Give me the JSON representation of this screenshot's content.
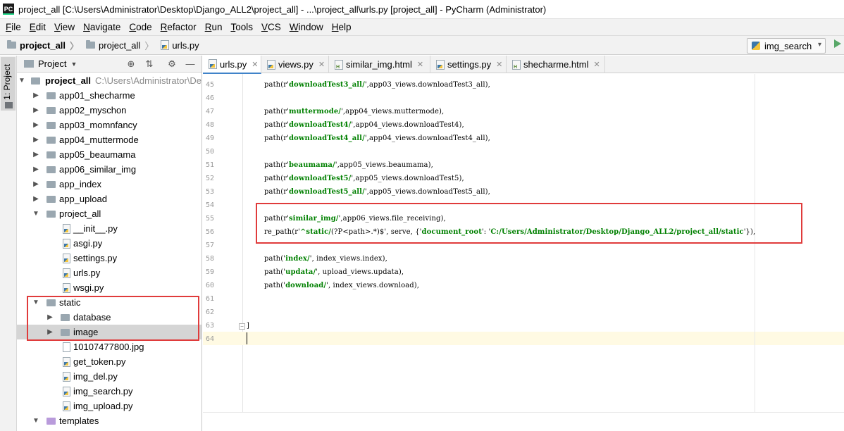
{
  "window": {
    "title": "project_all [C:\\Users\\Administrator\\Desktop\\Django_ALL2\\project_all] - ...\\project_all\\urls.py [project_all] - PyCharm (Administrator)",
    "app_icon_text": "PC"
  },
  "menu": [
    "File",
    "Edit",
    "View",
    "Navigate",
    "Code",
    "Refactor",
    "Run",
    "Tools",
    "VCS",
    "Window",
    "Help"
  ],
  "breadcrumb": [
    "project_all",
    "project_all",
    "urls.py"
  ],
  "run_config": {
    "label": "img_search"
  },
  "tool_strip": {
    "label": "1: Project"
  },
  "project_panel": {
    "title": "Project",
    "tree": [
      {
        "label": "project_all",
        "path": "C:\\Users\\Administrator\\De"
      },
      {
        "label": "app01_shecharme"
      },
      {
        "label": "app02_myschon"
      },
      {
        "label": "app03_momnfancy"
      },
      {
        "label": "app04_muttermode"
      },
      {
        "label": "app05_beaumama"
      },
      {
        "label": "app06_similar_img"
      },
      {
        "label": "app_index"
      },
      {
        "label": "app_upload"
      },
      {
        "label": "project_all"
      },
      {
        "label": "__init__.py"
      },
      {
        "label": "asgi.py"
      },
      {
        "label": "settings.py"
      },
      {
        "label": "urls.py"
      },
      {
        "label": "wsgi.py"
      },
      {
        "label": "static"
      },
      {
        "label": "database"
      },
      {
        "label": "image"
      },
      {
        "label": "10107477800.jpg"
      },
      {
        "label": "get_token.py"
      },
      {
        "label": "img_del.py"
      },
      {
        "label": "img_search.py"
      },
      {
        "label": "img_upload.py"
      },
      {
        "label": "templates"
      }
    ]
  },
  "editor": {
    "tabs": [
      {
        "label": "urls.py"
      },
      {
        "label": "views.py"
      },
      {
        "label": "similar_img.html"
      },
      {
        "label": "settings.py"
      },
      {
        "label": "shecharme.html"
      }
    ],
    "line_numbers": [
      "45",
      "46",
      "47",
      "48",
      "49",
      "50",
      "51",
      "52",
      "53",
      "54",
      "55",
      "56",
      "57",
      "58",
      "59",
      "60",
      "61",
      "62",
      "63",
      "64"
    ],
    "lines": [
      [
        "path(r'",
        "downloadTest3_all/",
        "',app03_views.downloadTest3_all),"
      ],
      [
        "",
        "",
        ""
      ],
      [
        "path(r'",
        "muttermode/",
        "',app04_views.muttermode),"
      ],
      [
        "path(r'",
        "downloadTest4/",
        "',app04_views.downloadTest4),"
      ],
      [
        "path(r'",
        "downloadTest4_all/",
        "',app04_views.downloadTest4_all),"
      ],
      [
        "",
        "",
        ""
      ],
      [
        "path(r'",
        "beaumama/",
        "',app05_views.beaumama),"
      ],
      [
        "path(r'",
        "downloadTest5/",
        "',app05_views.downloadTest5),"
      ],
      [
        "path(r'",
        "downloadTest5_all/",
        "',app05_views.downloadTest5_all),"
      ],
      [
        "",
        "",
        ""
      ],
      [
        "path(r'",
        "similar_img/",
        "',app06_views.file_receiving),"
      ],
      [
        "re_path(r'",
        "^static/",
        "(?P<path>.*)$', serve, {'",
        "document_root",
        "': '",
        "C:/Users/Administrator/Desktop/Django_ALL2/project_all/static",
        "'}),"
      ],
      [
        "",
        "",
        ""
      ],
      [
        "path('",
        "index/",
        "', index_views.index),"
      ],
      [
        "path('",
        "updata/",
        "', upload_views.updata),"
      ],
      [
        "path('",
        "download/",
        "', index_views.download),"
      ],
      [
        "",
        "",
        ""
      ],
      [
        "",
        "",
        ""
      ],
      [
        "]",
        "",
        ""
      ],
      [
        "",
        "",
        ""
      ]
    ]
  },
  "colors": {
    "highlight_box": "#e03b3b",
    "string": "#008000",
    "caret_line": "#fffae3",
    "active_tab_underline": "#4083c9"
  }
}
